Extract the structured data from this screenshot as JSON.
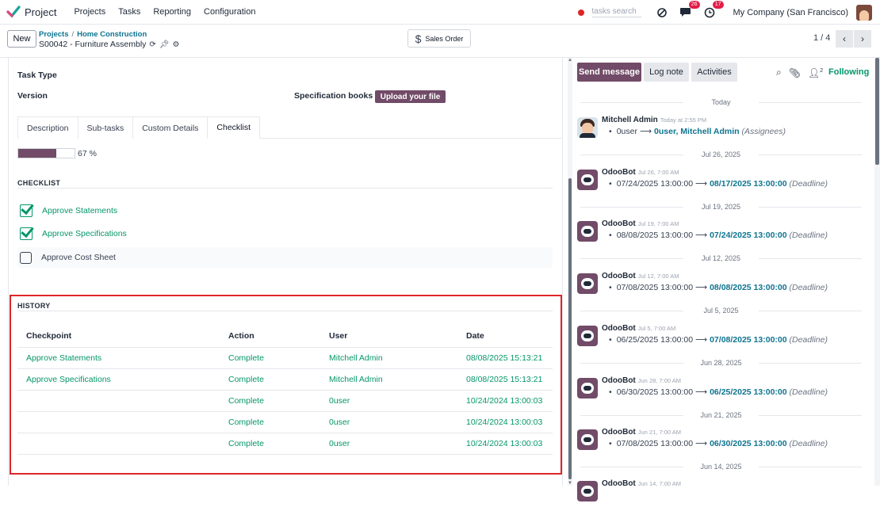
{
  "topbar": {
    "app_name": "Project",
    "menu": [
      "Projects",
      "Tasks",
      "Reporting",
      "Configuration"
    ],
    "search_placeholder": "tasks search",
    "chat_badge": "26",
    "activity_badge": "17",
    "company": "My Company (San Francisco)"
  },
  "control": {
    "new_label": "New",
    "breadcrumb": [
      "Projects",
      "Home Construction"
    ],
    "record_name": "S00042 - Furniture Assembly",
    "smart_button": "Sales Order",
    "pager": "1 / 4"
  },
  "form": {
    "task_type_label": "Task Type",
    "version_label": "Version",
    "spec_books_label": "Specification books",
    "upload_label": "Upload your file",
    "tabs": [
      "Description",
      "Sub-tasks",
      "Custom Details",
      "Checklist"
    ],
    "active_tab": "Checklist",
    "progress_value": 67,
    "progress_text": "67 %",
    "checklist_heading": "CHECKLIST",
    "checklist": [
      {
        "label": "Approve Statements",
        "done": true
      },
      {
        "label": "Approve Specifications",
        "done": true
      },
      {
        "label": "Approve Cost Sheet",
        "done": false
      }
    ],
    "history_heading": "HISTORY",
    "history_columns": [
      "Checkpoint",
      "Action",
      "User",
      "Date"
    ],
    "history_rows": [
      [
        "Approve Statements",
        "Complete",
        "Mitchell Admin",
        "08/08/2025 15:13:21"
      ],
      [
        "Approve Specifications",
        "Complete",
        "Mitchell Admin",
        "08/08/2025 15:13:21"
      ],
      [
        "",
        "Complete",
        "0user",
        "10/24/2024 13:00:03"
      ],
      [
        "",
        "Complete",
        "0user",
        "10/24/2024 13:00:03"
      ],
      [
        "",
        "Complete",
        "0user",
        "10/24/2024 13:00:03"
      ]
    ]
  },
  "chatter": {
    "send_message": "Send message",
    "log_note": "Log note",
    "activities": "Activities",
    "followers_count": "2",
    "following": "Following",
    "colors": {
      "primary": "#714b67",
      "link": "#0e7490",
      "success": "#059669"
    },
    "dates": [
      "Today",
      "Jul 26, 2025",
      "Jul 19, 2025",
      "Jul 12, 2025",
      "Jul 5, 2025",
      "Jun 28, 2025",
      "Jun 21, 2025",
      "Jun 14, 2025"
    ],
    "messages": [
      {
        "author": "Mitchell Admin",
        "when": "Today at 2:55 PM",
        "old": "0user",
        "new": "0user, Mitchell Admin",
        "field": "(Assignees)"
      },
      {
        "author": "OdooBot",
        "when": "Jul 26, 7:00 AM",
        "old": "07/24/2025 13:00:00",
        "new": "08/17/2025 13:00:00",
        "field": "(Deadline)"
      },
      {
        "author": "OdooBot",
        "when": "Jul 19, 7:00 AM",
        "old": "08/08/2025 13:00:00",
        "new": "07/24/2025 13:00:00",
        "field": "(Deadline)"
      },
      {
        "author": "OdooBot",
        "when": "Jul 12, 7:00 AM",
        "old": "07/08/2025 13:00:00",
        "new": "08/08/2025 13:00:00",
        "field": "(Deadline)"
      },
      {
        "author": "OdooBot",
        "when": "Jul 5, 7:00 AM",
        "old": "06/25/2025 13:00:00",
        "new": "07/08/2025 13:00:00",
        "field": "(Deadline)"
      },
      {
        "author": "OdooBot",
        "when": "Jun 28, 7:00 AM",
        "old": "06/30/2025 13:00:00",
        "new": "06/25/2025 13:00:00",
        "field": "(Deadline)"
      },
      {
        "author": "OdooBot",
        "when": "Jun 21, 7:00 AM",
        "old": "07/08/2025 13:00:00",
        "new": "06/30/2025 13:00:00",
        "field": "(Deadline)"
      },
      {
        "author": "OdooBot",
        "when": "Jun 14, 7:00 AM"
      }
    ]
  }
}
